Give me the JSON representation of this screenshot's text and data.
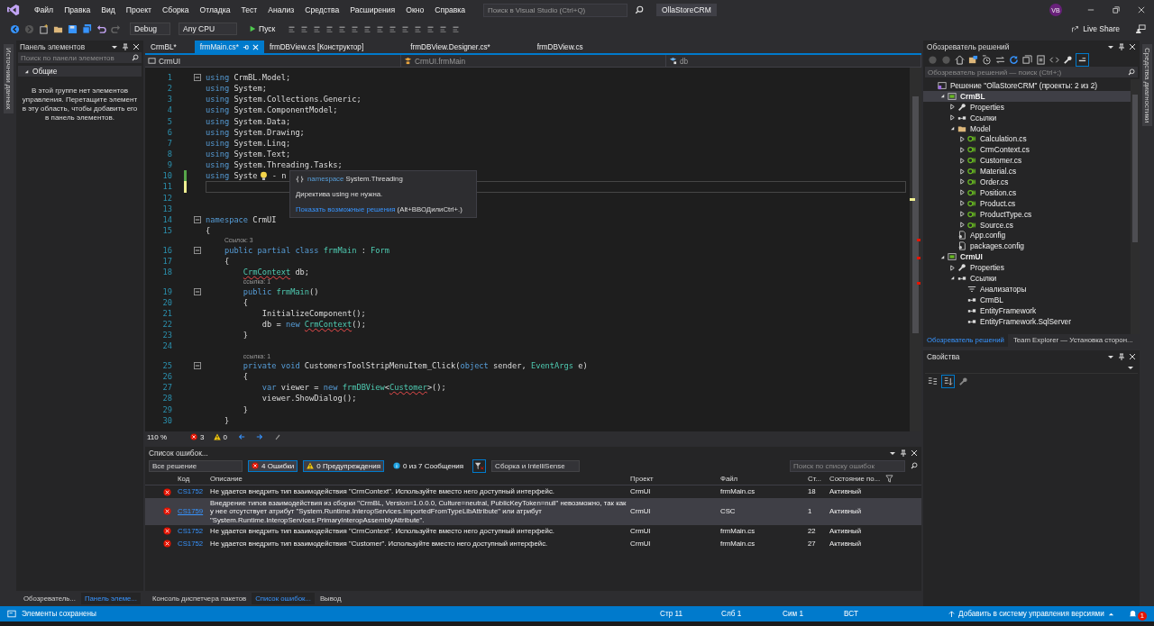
{
  "menu": [
    "Файл",
    "Правка",
    "Вид",
    "Проект",
    "Сборка",
    "Отладка",
    "Тест",
    "Анализ",
    "Средства",
    "Расширения",
    "Окно",
    "Справка"
  ],
  "search": {
    "placeholder": "Поиск в Visual Studio (Ctrl+Q)"
  },
  "project_name": "OllaStoreCRM",
  "avatar": "VB",
  "toolbar": {
    "configuration": "Debug",
    "platform": "Any CPU",
    "start": "Пуск",
    "live_share": "Live Share"
  },
  "left_strip": "Источники данных",
  "toolbox": {
    "title": "Панель элементов",
    "placeholder": "Поиск по панели элементов",
    "group": {
      "label": "Общие",
      "expanded": true
    },
    "message": "В этой группе нет элементов управления. Перетащите элемент в эту область, чтобы добавить его в панель элементов.",
    "tabs": [
      {
        "label": "Обозреватель...",
        "selected": false
      },
      {
        "label": "Панель элеме...",
        "selected": true
      }
    ]
  },
  "editor": {
    "tabs": [
      {
        "label": "CrmBL*",
        "selected": false
      },
      {
        "label": "frmMain.cs*",
        "selected": true
      },
      {
        "label": "frmDBView.cs [Конструктор]",
        "selected": false
      },
      {
        "label": "frmDBView.Designer.cs*",
        "selected": false
      },
      {
        "label": "frmDBView.cs",
        "selected": false
      }
    ],
    "nav": [
      "CrmUI",
      "CrmUI.frmMain",
      "db"
    ],
    "lines": [
      {
        "num": "1",
        "expanded": true,
        "tokens": [
          {
            "t": "using",
            "kind": "kw"
          },
          {
            "t": " CrmBL.Model;",
            "kind": "text"
          }
        ]
      },
      {
        "num": "2",
        "tokens": [
          {
            "t": "using",
            "kind": "kw"
          },
          {
            "t": " System;",
            "kind": "text"
          }
        ]
      },
      {
        "num": "3",
        "tokens": [
          {
            "t": "using",
            "kind": "kw"
          },
          {
            "t": " System.Collections.Generic;",
            "kind": "text"
          }
        ]
      },
      {
        "num": "4",
        "tokens": [
          {
            "t": "using",
            "kind": "kw"
          },
          {
            "t": " System.ComponentModel;",
            "kind": "text"
          }
        ]
      },
      {
        "num": "5",
        "tokens": [
          {
            "t": "using",
            "kind": "kw"
          },
          {
            "t": " System.Data;",
            "kind": "text"
          }
        ]
      },
      {
        "num": "6",
        "tokens": [
          {
            "t": "using",
            "kind": "kw"
          },
          {
            "t": " System.Drawing;",
            "kind": "text"
          }
        ]
      },
      {
        "num": "7",
        "tokens": [
          {
            "t": "using",
            "kind": "kw"
          },
          {
            "t": " System.Linq;",
            "kind": "text"
          }
        ]
      },
      {
        "num": "8",
        "tokens": [
          {
            "t": "using",
            "kind": "kw"
          },
          {
            "t": " System.Text;",
            "kind": "text"
          }
        ]
      },
      {
        "num": "9",
        "tokens": [
          {
            "t": "using",
            "kind": "kw"
          },
          {
            "t": " System.Threading.Tasks;",
            "kind": "text"
          }
        ]
      },
      {
        "num": "10",
        "changed": true,
        "saved": true,
        "tokens": [
          {
            "t": "using",
            "kind": "kw"
          },
          {
            "t": " Syste",
            "kind": "text"
          },
          {
            "kind": "bulb"
          },
          {
            "t": " - n",
            "kind": "text"
          }
        ]
      },
      {
        "num": "11",
        "changed": true,
        "saved": false,
        "current": true
      },
      {
        "num": "12"
      },
      {
        "num": "13"
      },
      {
        "num": "14",
        "expanded": true,
        "tokens": [
          {
            "t": "namespace",
            "kind": "kw"
          },
          {
            "t": " CrmUI",
            "kind": "text"
          }
        ]
      },
      {
        "num": "15",
        "tokens": [
          {
            "t": "{",
            "kind": "text"
          }
        ]
      },
      {
        "lens": "Ссылок: 3"
      },
      {
        "num": "16",
        "expanded": true,
        "tokens": [
          {
            "t": "    public partial class",
            "kind": "kw"
          },
          {
            "t": " frmMain",
            "kind": "type"
          },
          {
            "t": " : ",
            "kind": "text"
          },
          {
            "t": "Form",
            "kind": "type"
          }
        ]
      },
      {
        "num": "17",
        "tokens": [
          {
            "t": "    {",
            "kind": "text"
          }
        ]
      },
      {
        "num": "18",
        "tokens": [
          {
            "t": "        CrmContext",
            "kind": "err"
          },
          {
            "t": " db;",
            "kind": "text"
          }
        ]
      },
      {
        "lens": "ссылка: 1"
      },
      {
        "num": "19",
        "expanded": true,
        "tokens": [
          {
            "t": "        public",
            "kind": "kw"
          },
          {
            "t": " frmMain",
            "kind": "type"
          },
          {
            "t": "()",
            "kind": "text"
          }
        ]
      },
      {
        "num": "20",
        "tokens": [
          {
            "t": "        {",
            "kind": "text"
          }
        ]
      },
      {
        "num": "21",
        "tokens": [
          {
            "t": "            InitializeComponent();",
            "kind": "text"
          }
        ]
      },
      {
        "num": "22",
        "tokens": [
          {
            "t": "            db = ",
            "kind": "text"
          },
          {
            "t": "new",
            "kind": "kw"
          },
          {
            "t": " CrmContext",
            "kind": "err"
          },
          {
            "t": "();",
            "kind": "text"
          }
        ]
      },
      {
        "num": "23",
        "tokens": [
          {
            "t": "        }",
            "kind": "text"
          }
        ]
      },
      {
        "num": "24"
      },
      {
        "lens": "ссылка: 1"
      },
      {
        "num": "25",
        "expanded": true,
        "tokens": [
          {
            "t": "        private void",
            "kind": "kw"
          },
          {
            "t": " CustomersToolStripMenuItem_Click(",
            "kind": "text"
          },
          {
            "t": "object",
            "kind": "kw"
          },
          {
            "t": " sender, ",
            "kind": "text"
          },
          {
            "t": "EventArgs",
            "kind": "type"
          },
          {
            "t": " e)",
            "kind": "text"
          }
        ]
      },
      {
        "num": "26",
        "tokens": [
          {
            "t": "        {",
            "kind": "text"
          }
        ]
      },
      {
        "num": "27",
        "tokens": [
          {
            "t": "            var",
            "kind": "kw"
          },
          {
            "t": " viewer = ",
            "kind": "text"
          },
          {
            "t": "new",
            "kind": "kw"
          },
          {
            "t": " frmDBView",
            "kind": "type"
          },
          {
            "t": "<",
            "kind": "text"
          },
          {
            "t": "Customer",
            "kind": "err"
          },
          {
            "t": ">();",
            "kind": "text"
          }
        ]
      },
      {
        "num": "28",
        "tokens": [
          {
            "t": "            viewer.ShowDialog();",
            "kind": "text"
          }
        ]
      },
      {
        "num": "29",
        "tokens": [
          {
            "t": "        }",
            "kind": "text"
          }
        ]
      },
      {
        "num": "30",
        "tokens": [
          {
            "t": "    }",
            "kind": "text"
          }
        ]
      }
    ],
    "tooltip": {
      "keyword": "namespace",
      "name": "System.Threading",
      "message": "Директива using не нужна.",
      "link": "Показать возможные решения",
      "shortcut": "(Alt+ВВОДилиCtrl+.)"
    },
    "zoom": "110 %",
    "error_count": "3",
    "warning_count": "0"
  },
  "error_list": {
    "title": "Список ошибок...",
    "scope": "Все решение",
    "filters": [
      {
        "label": "4 Ошибки",
        "kind": "error",
        "selected": true
      },
      {
        "label": "0 Предупреждения",
        "kind": "warning",
        "selected": true
      },
      {
        "label": "0 из 7 Сообщения",
        "kind": "info",
        "selected": false
      }
    ],
    "source": "Сборка и IntelliSense",
    "placeholder": "Поиск по списку ошибок",
    "columns": [
      "Код",
      "Описание",
      "Проект",
      "Файл",
      "Ст...",
      "Состояние по..."
    ],
    "rows": [
      {
        "code": "CS1752",
        "description": "Не удается внедрить тип взаимодействия \"CrmContext\". Используйте вместо него доступный интерфейс.",
        "project": "CrmUI",
        "file": "frmMain.cs",
        "line": "18",
        "state": "Активный",
        "selected": false
      },
      {
        "code": "CS1759",
        "description": "Внедрение типов взаимодействия из сборки \"CrmBL, Version=1.0.0.0, Culture=neutral, PublicKeyToken=null\" невозможно, так как у нее отсутствует атрибут \"System.Runtime.InteropServices.ImportedFromTypeLibAttribute\" или атрибут \"System.Runtime.InteropServices.PrimaryInteropAssemblyAttribute\".",
        "project": "CrmUI",
        "file": "CSC",
        "line": "1",
        "state": "Активный",
        "selected": true
      },
      {
        "code": "CS1752",
        "description": "Не удается внедрить тип взаимодействия \"CrmContext\". Используйте вместо него доступный интерфейс.",
        "project": "CrmUI",
        "file": "frmMain.cs",
        "line": "22",
        "state": "Активный",
        "selected": false
      },
      {
        "code": "CS1752",
        "description": "Не удается внедрить тип взаимодействия \"Customer\". Используйте вместо него доступный интерфейс.",
        "project": "CrmUI",
        "file": "frmMain.cs",
        "line": "27",
        "state": "Активный",
        "selected": false
      }
    ]
  },
  "bottom_tabs": [
    {
      "label": "Консоль диспетчера пакетов",
      "selected": false
    },
    {
      "label": "Список ошибок...",
      "selected": true
    },
    {
      "label": "Вывод",
      "selected": false
    }
  ],
  "solution": {
    "title": "Обозреватель решений",
    "placeholder": "Обозреватель решений — поиск (Ctrl+;)",
    "tree": [
      {
        "label": "Решение \"OllaStoreCRM\" (проекты: 2 из 2)",
        "kind": "solution",
        "selected": false,
        "children": [
          {
            "label": "CrmBL",
            "kind": "project",
            "expanded": true,
            "selected": true,
            "children": [
              {
                "label": "Properties",
                "kind": "properties",
                "expanded": false,
                "selected": false
              },
              {
                "label": "Ссылки",
                "kind": "references",
                "expanded": false,
                "selected": false
              },
              {
                "label": "Model",
                "kind": "folder",
                "expanded": true,
                "selected": false,
                "children": [
                  {
                    "label": "Calculation.cs",
                    "kind": "code",
                    "expanded": false,
                    "selected": false
                  },
                  {
                    "label": "CrmContext.cs",
                    "kind": "code",
                    "expanded": false,
                    "selected": false
                  },
                  {
                    "label": "Customer.cs",
                    "kind": "code",
                    "expanded": false,
                    "selected": false
                  },
                  {
                    "label": "Material.cs",
                    "kind": "code",
                    "expanded": false,
                    "selected": false
                  },
                  {
                    "label": "Order.cs",
                    "kind": "code",
                    "expanded": false,
                    "selected": false
                  },
                  {
                    "label": "Position.cs",
                    "kind": "code",
                    "expanded": false,
                    "selected": false
                  },
                  {
                    "label": "Product.cs",
                    "kind": "code",
                    "expanded": false,
                    "selected": false
                  },
                  {
                    "label": "ProductType.cs",
                    "kind": "code",
                    "expanded": false,
                    "selected": false
                  },
                  {
                    "label": "Source.cs",
                    "kind": "code",
                    "expanded": false,
                    "selected": false
                  }
                ]
              },
              {
                "label": "App.config",
                "kind": "config",
                "selected": false
              },
              {
                "label": "packages.config",
                "kind": "config",
                "selected": false
              }
            ]
          },
          {
            "label": "CrmUI",
            "kind": "project",
            "expanded": true,
            "selected": false,
            "children": [
              {
                "label": "Properties",
                "kind": "properties",
                "expanded": false,
                "selected": false
              },
              {
                "label": "Ссылки",
                "kind": "references",
                "expanded": true,
                "selected": false,
                "children": [
                  {
                    "label": "Анализаторы",
                    "kind": "analyzer",
                    "selected": false
                  },
                  {
                    "label": "CrmBL",
                    "kind": "reference",
                    "selected": false
                  },
                  {
                    "label": "EntityFramework",
                    "kind": "reference",
                    "selected": false
                  },
                  {
                    "label": "EntityFramework.SqlServer",
                    "kind": "reference",
                    "selected": false
                  }
                ]
              }
            ]
          }
        ]
      }
    ],
    "tabs": [
      {
        "label": "Обозреватель решений",
        "selected": true
      },
      {
        "label": "Team Explorer — Установка сторон...",
        "selected": false
      }
    ]
  },
  "properties": {
    "title": "Свойства"
  },
  "right_strip": "Средства диагностики",
  "status_bar": {
    "message": "Элементы сохранены",
    "line": "Стр 11",
    "column": "Слб 1",
    "char": "Сим 1",
    "mode": "ВСТ",
    "source_control": "Добавить в систему управления версиями",
    "notifications": "1"
  }
}
